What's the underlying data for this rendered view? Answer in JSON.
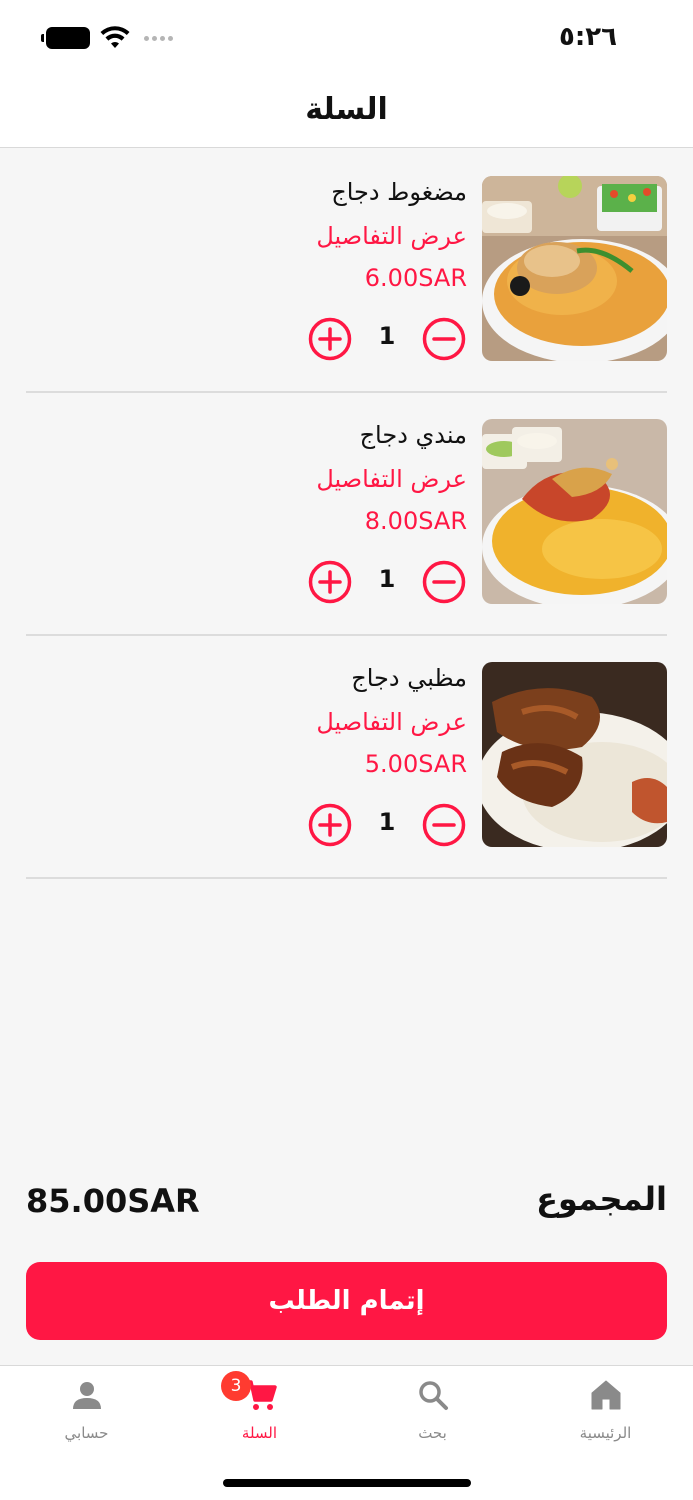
{
  "status_bar": {
    "time": "٥:٢٦"
  },
  "header": {
    "title": "السلة"
  },
  "cart": {
    "items": [
      {
        "name": "مضغوط دجاج",
        "details_link": "عرض التفاصيل",
        "price": "6.00SAR",
        "quantity": "1",
        "image": "chicken-madghoot-photo"
      },
      {
        "name": "مندي دجاج",
        "details_link": "عرض التفاصيل",
        "price": "8.00SAR",
        "quantity": "1",
        "image": "chicken-mandi-photo"
      },
      {
        "name": "مظبي دجاج",
        "details_link": "عرض التفاصيل",
        "price": "5.00SAR",
        "quantity": "1",
        "image": "chicken-madhbi-photo"
      }
    ]
  },
  "summary": {
    "total_label": "المجموع",
    "total_value": "85.00SAR"
  },
  "checkout": {
    "label": "إتمام الطلب"
  },
  "tab_bar": {
    "account": {
      "label": "حسابي",
      "icon": "person-icon"
    },
    "cart": {
      "label": "السلة",
      "icon": "cart-icon",
      "badge": "3"
    },
    "search": {
      "label": "بحث",
      "icon": "search-icon"
    },
    "home": {
      "label": "الرئيسية",
      "icon": "home-icon"
    }
  },
  "colors": {
    "accent": "#ff1744",
    "badge": "#ff3b30",
    "inactive_tab": "#8a8a8a"
  }
}
